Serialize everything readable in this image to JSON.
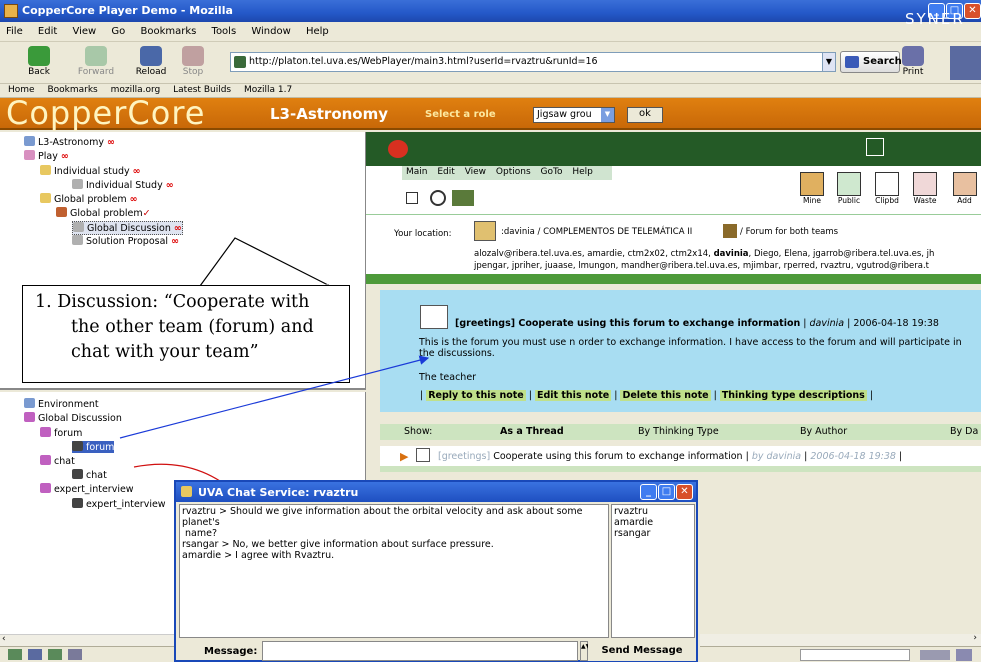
{
  "window": {
    "title": "CopperCore Player Demo - Mozilla"
  },
  "menu": [
    "File",
    "Edit",
    "View",
    "Go",
    "Bookmarks",
    "Tools",
    "Window",
    "Help"
  ],
  "nav": {
    "back": "Back",
    "forward": "Forward",
    "reload": "Reload",
    "stop": "Stop",
    "print": "Print",
    "search": "Search"
  },
  "url": "http://platon.tel.uva.es/WebPlayer/main3.html?userId=rvaztru&runId=16",
  "bookmarks": [
    "Home",
    "Bookmarks",
    "mozilla.org",
    "Latest Builds",
    "Mozilla 1.7"
  ],
  "coppercore": {
    "logo": "CopperCore",
    "course": "L3-Astronomy",
    "role_label": "Select a role",
    "role_value": "Jigsaw grou",
    "ok": "ok"
  },
  "play_tree": {
    "root": "L3-Astronomy",
    "play": "Play",
    "individual_study": "Individual study",
    "individual_study_act": "Individual Study",
    "global_problem_phase": "Global problem",
    "global_problem": "Global problem",
    "global_discussion": "Global Discussion",
    "solution_proposal": "Solution Proposal"
  },
  "callout": {
    "line1": "1. Discussion: “Cooperate with",
    "line2": "the other team (forum) and",
    "line3": "chat with your team”"
  },
  "env_tree": {
    "environment": "Environment",
    "global_discussion": "Global Discussion",
    "forum_folder": "forum",
    "forum": "forum",
    "chat_folder": "chat",
    "chat": "chat",
    "expert_folder": "expert_interview",
    "expert": "expert_interview"
  },
  "synergeia": {
    "logo": "SYNER",
    "menu": [
      "Main",
      "Edit",
      "View",
      "Options",
      "GoTo",
      "Help"
    ],
    "tools": [
      "Mine",
      "Public",
      "Clipbd",
      "Waste",
      "Add"
    ],
    "location_label": "Your location:",
    "location_path": ":davinia / COMPLEMENTOS DE TELEMÁTICA II",
    "location_forum": "/ Forum for both teams",
    "members_1_pre": "alozalv@ribera.tel.uva.es, amardie, ctm2x02, ctm2x14, ",
    "members_1_bold": "davinia",
    "members_1_post": ", Diego, Elena, jgarrob@ribera.tel.uva.es, jh",
    "members_2": "jpengar, jpriher, juaase, lmungon, mandher@ribera.tel.uva.es, mjimbar, rperred, rvaztru, vgutrod@ribera.t"
  },
  "note": {
    "title": "[greetings] Cooperate using this forum to exchange information",
    "author": "davinia",
    "date": "2006-04-18 19:38",
    "body": "This is the forum you must use n order to exchange information. I have access to the forum and will participate in the discussions.",
    "signature": "The teacher",
    "actions": [
      "Reply to this note",
      "Edit this note",
      "Delete this note",
      "Thinking type descriptions"
    ]
  },
  "show_bar": {
    "label": "Show:",
    "thread": "As a Thread",
    "thinking": "By Thinking Type",
    "author": "By Author",
    "date": "By Da"
  },
  "thread": {
    "tag": "[greetings]",
    "title": "Cooperate using this forum to exchange information",
    "by": "by davinia",
    "date": "2006-04-18 19:38"
  },
  "chat": {
    "title": "UVA Chat Service: rvaztru",
    "lines": [
      "rvaztru > Should we give information about the orbital velocity and ask about some planet's",
      " name?",
      "rsangar > No, we better give information about surface pressure.",
      "amardie > I agree with Rvaztru."
    ],
    "users": [
      "rvaztru",
      "amardie",
      "rsangar"
    ],
    "message_label": "Message:",
    "send": "Send Message"
  },
  "colors": {
    "coppercore_orange": "#d87410",
    "synergeia_green": "#245a26",
    "note_blue": "#a8ddf2",
    "xp_blue": "#2458c8"
  }
}
